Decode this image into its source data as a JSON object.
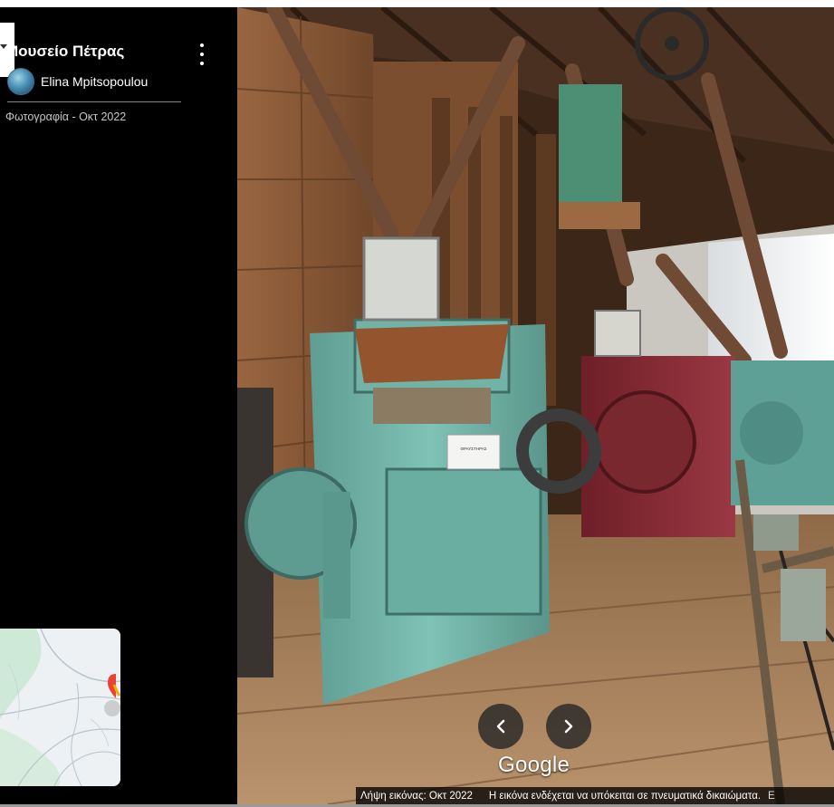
{
  "panel": {
    "title": "Μουσείο Πέτρας",
    "author": "Elina Mpitsopoulou",
    "meta": "Φωτογραφία - Οκτ 2022",
    "menu_icon": "more-vert-icon",
    "avatar_icon": "avatar-icon"
  },
  "viewer": {
    "logo": "Google",
    "prev_icon": "chevron-left-icon",
    "next_icon": "chevron-right-icon",
    "sign_text": "ΘΡΑΥΣΤΗΡΑΣ"
  },
  "footer": {
    "date": "Λήψη εικόνας: Οκτ 2022",
    "copyright": "Η εικόνα ενδέχεται να υπόκειται σε πνευματικά δικαιώματα.",
    "more": "E"
  },
  "colors": {
    "panel_bg": "#000000",
    "machine_teal": "#6fb3a7",
    "machine_red": "#8a2b33",
    "wood": "#8a5a36",
    "map_pin": "#ea4335"
  }
}
